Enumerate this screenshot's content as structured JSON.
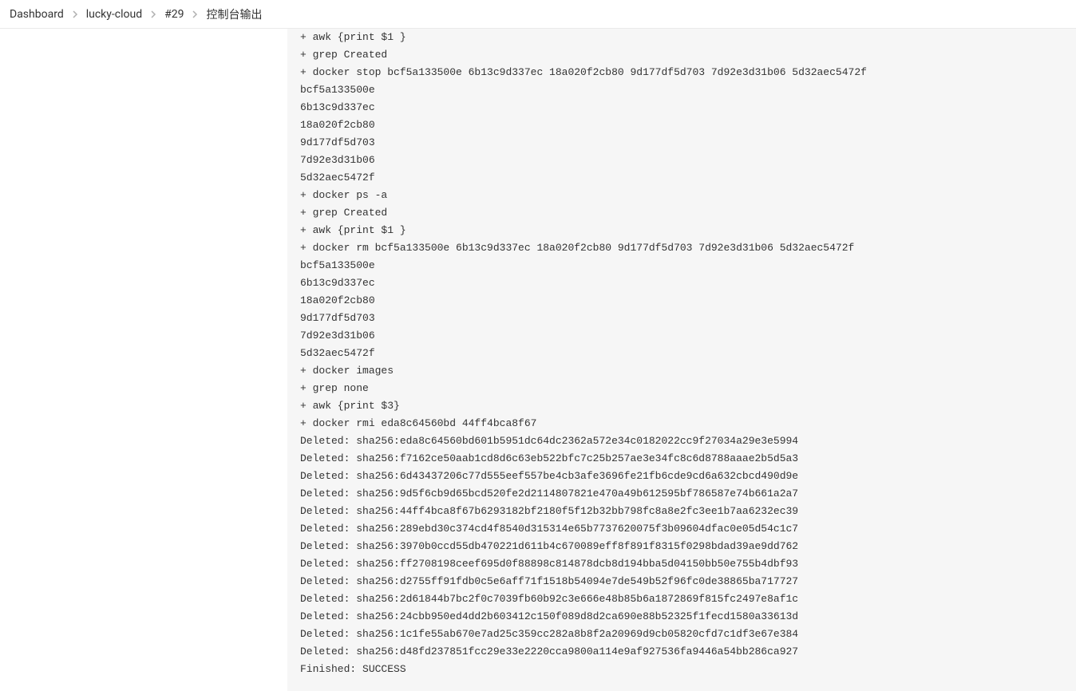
{
  "breadcrumb": {
    "items": [
      {
        "label": "Dashboard"
      },
      {
        "label": "lucky-cloud"
      },
      {
        "label": "#29"
      },
      {
        "label": "控制台输出"
      }
    ]
  },
  "console": {
    "lines": [
      "+ awk {print $1 }",
      "+ grep Created",
      "+ docker stop bcf5a133500e 6b13c9d337ec 18a020f2cb80 9d177df5d703 7d92e3d31b06 5d32aec5472f",
      "bcf5a133500e",
      "6b13c9d337ec",
      "18a020f2cb80",
      "9d177df5d703",
      "7d92e3d31b06",
      "5d32aec5472f",
      "+ docker ps -a",
      "+ grep Created",
      "+ awk {print $1 }",
      "+ docker rm bcf5a133500e 6b13c9d337ec 18a020f2cb80 9d177df5d703 7d92e3d31b06 5d32aec5472f",
      "bcf5a133500e",
      "6b13c9d337ec",
      "18a020f2cb80",
      "9d177df5d703",
      "7d92e3d31b06",
      "5d32aec5472f",
      "+ docker images",
      "+ grep none",
      "+ awk {print $3}",
      "+ docker rmi eda8c64560bd 44ff4bca8f67",
      "Deleted: sha256:eda8c64560bd601b5951dc64dc2362a572e34c0182022cc9f27034a29e3e5994",
      "Deleted: sha256:f7162ce50aab1cd8d6c63eb522bfc7c25b257ae3e34fc8c6d8788aaae2b5d5a3",
      "Deleted: sha256:6d43437206c77d555eef557be4cb3afe3696fe21fb6cde9cd6a632cbcd490d9e",
      "Deleted: sha256:9d5f6cb9d65bcd520fe2d2114807821e470a49b612595bf786587e74b661a2a7",
      "Deleted: sha256:44ff4bca8f67b6293182bf2180f5f12b32bb798fc8a8e2fc3ee1b7aa6232ec39",
      "Deleted: sha256:289ebd30c374cd4f8540d315314e65b7737620075f3b09604dfac0e05d54c1c7",
      "Deleted: sha256:3970b0ccd55db470221d611b4c670089eff8f891f8315f0298bdad39ae9dd762",
      "Deleted: sha256:ff2708198ceef695d0f88898c814878dcb8d194bba5d04150bb50e755b4dbf93",
      "Deleted: sha256:d2755ff91fdb0c5e6aff71f1518b54094e7de549b52f96fc0de38865ba717727",
      "Deleted: sha256:2d61844b7bc2f0c7039fb60b92c3e666e48b85b6a1872869f815fc2497e8af1c",
      "Deleted: sha256:24cbb950ed4dd2b603412c150f089d8d2ca690e88b52325f1fecd1580a33613d",
      "Deleted: sha256:1c1fe55ab670e7ad25c359cc282a8b8f2a20969d9cb05820cfd7c1df3e67e384",
      "Deleted: sha256:d48fd237851fcc29e33e2220cca9800a114e9af927536fa9446a54bb286ca927",
      "Finished: SUCCESS"
    ]
  }
}
